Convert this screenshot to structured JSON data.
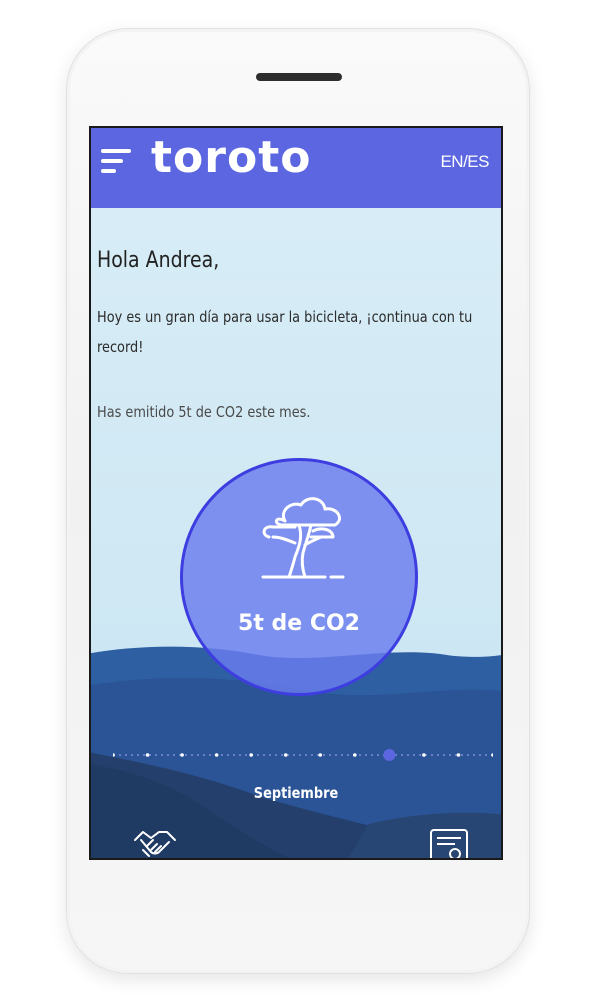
{
  "header": {
    "brand": "toroto",
    "language_toggle": "EN/ES",
    "menu_icon": "hamburger-menu-icon",
    "bar_color": "#5b66e0"
  },
  "main": {
    "greeting": "Hola Andrea,",
    "message": "Hoy es un gran día para usar la bicicleta, ¡continua con tu record!",
    "emissions_text": "Has emitido 5t de CO2 este mes.",
    "co2_badge": {
      "icon": "tree-icon",
      "value": "5t de CO2",
      "color": "#6a7cee"
    },
    "month_selector": {
      "label": "Septiembre",
      "steps": 12,
      "selected_index": 8
    }
  },
  "bottom_nav": {
    "left_icon": "handshake-icon",
    "right_icon": "document-icon"
  }
}
